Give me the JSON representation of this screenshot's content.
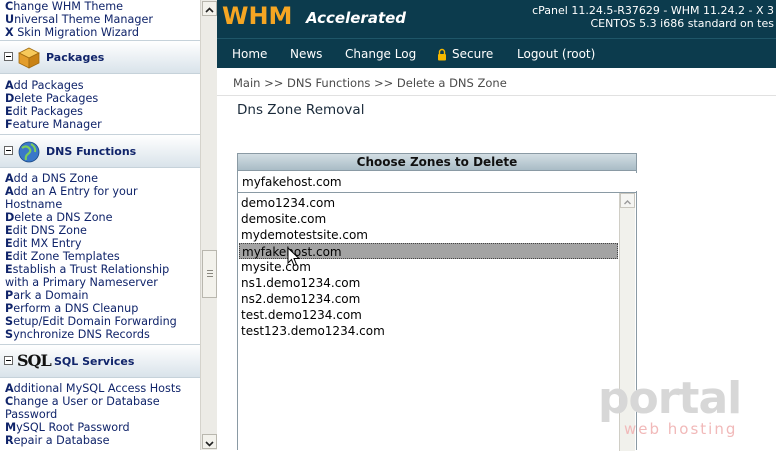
{
  "sidebar": {
    "top_links": [
      {
        "label": "Change WHM Theme",
        "first": "C"
      },
      {
        "label": "Universal Theme Manager",
        "first": "U"
      },
      {
        "label": "X Skin Migration Wizard",
        "first": "X"
      }
    ],
    "packages": {
      "title": "Packages",
      "icon": "package-box-icon",
      "items": [
        "Add Packages",
        "Delete Packages",
        "Edit Packages",
        "Feature Manager"
      ]
    },
    "dns": {
      "title": "DNS Functions",
      "icon": "globe-icon",
      "items": [
        "Add a DNS Zone",
        "Add an A Entry for your",
        "Hostname",
        "Delete a DNS Zone",
        "Edit DNS Zone",
        "Edit MX Entry",
        "Edit Zone Templates",
        "Establish a Trust Relationship",
        "with a Primary Nameserver",
        "Park a Domain",
        "Perform a DNS Cleanup",
        "Setup/Edit Domain Forwarding",
        "Synchronize DNS Records"
      ]
    },
    "sql": {
      "logo_text": "SQL",
      "title": "SQL Services",
      "items": [
        "Additional MySQL Access Hosts",
        "Change a User or Database",
        "Password",
        "MySQL Root Password",
        "Repair a Database"
      ]
    }
  },
  "header": {
    "logo_whm": "WHM",
    "logo_accelerated": "Accelerated",
    "info_line1": "cPanel 11.24.5-R37629 - WHM 11.24.2 - X 3",
    "info_line2": "CENTOS 5.3 i686 standard on tes"
  },
  "nav": {
    "items": [
      "Home",
      "News",
      "Change Log",
      "Secure",
      "Logout (root)"
    ]
  },
  "breadcrumb": "Main >> DNS Functions >> Delete a DNS Zone",
  "page": {
    "title": "Dns Zone Removal",
    "box_header": "Choose Zones to Delete",
    "filter_value": "myfakehost.com",
    "zones": [
      "demo1234.com",
      "demosite.com",
      "mydemotestsite.com",
      "myfakehost.com",
      "mysite.com",
      "ns1.demo1234.com",
      "ns2.demo1234.com",
      "test.demo1234.com",
      "test123.demo1234.com"
    ],
    "selected_zone": "myfakehost.com"
  },
  "watermark": {
    "brand": "portal",
    "sub": "web hosting"
  },
  "colors": {
    "header_bg": "#0c3b4d",
    "logo_orange": "#f5a623",
    "link_blue": "#10246a",
    "selection_gray": "#a3a3a3"
  }
}
